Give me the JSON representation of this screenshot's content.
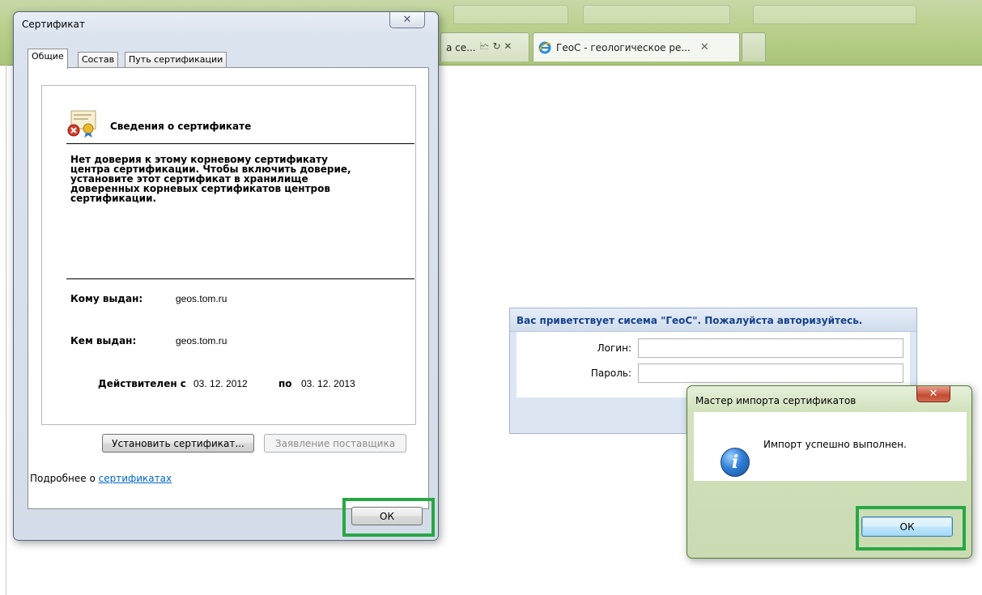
{
  "browser": {
    "tab_prev_label": "а се...",
    "tab_prev_controls": "🗠 ↻ ✕",
    "tab_active_label": "ГеоС - геологическое ре...",
    "tab_close": "✕"
  },
  "cert_dialog": {
    "title": "Сертификат",
    "close_glyph": "✕",
    "tabs": [
      "Общие",
      "Состав",
      "Путь сертификации"
    ],
    "info_title": "Сведения о сертификате",
    "trust_message": "Нет доверия к этому корневому сертификату\nцентра сертификации. Чтобы включить  доверие,\nустановите этот сертификат в хранилище\nдоверенных корневых сертификатов центров\nсертификации.",
    "issued_to_label": "Кому выдан:",
    "issued_to_value": "geos.tom.ru",
    "issued_by_label": "Кем выдан:",
    "issued_by_value": "geos.tom.ru",
    "valid_from_label": "Действителен с",
    "valid_from_value": "03. 12. 2012",
    "valid_to_label": "по",
    "valid_to_value": "03. 12. 2013",
    "install_button": "Установить сертификат...",
    "issuer_statement_button": "Заявление поставщика",
    "more_prefix": "Подробнее о ",
    "more_link": "сертификатах",
    "ok_button": "ОК"
  },
  "login_panel": {
    "title": "Вас приветствует сисема \"ГеоС\". Пожалуйста авторизуйтесь.",
    "login_label": "Логин:",
    "password_label": "Пароль:"
  },
  "import_dialog": {
    "title": "Мастер импорта сертификатов",
    "close_glyph": "✕",
    "message": "Импорт успешно выполнен.",
    "info_glyph": "i",
    "ok_button": "ОК"
  },
  "colors": {
    "highlight": "#27a844",
    "link": "#0066cc",
    "login_title": "#15428b"
  }
}
